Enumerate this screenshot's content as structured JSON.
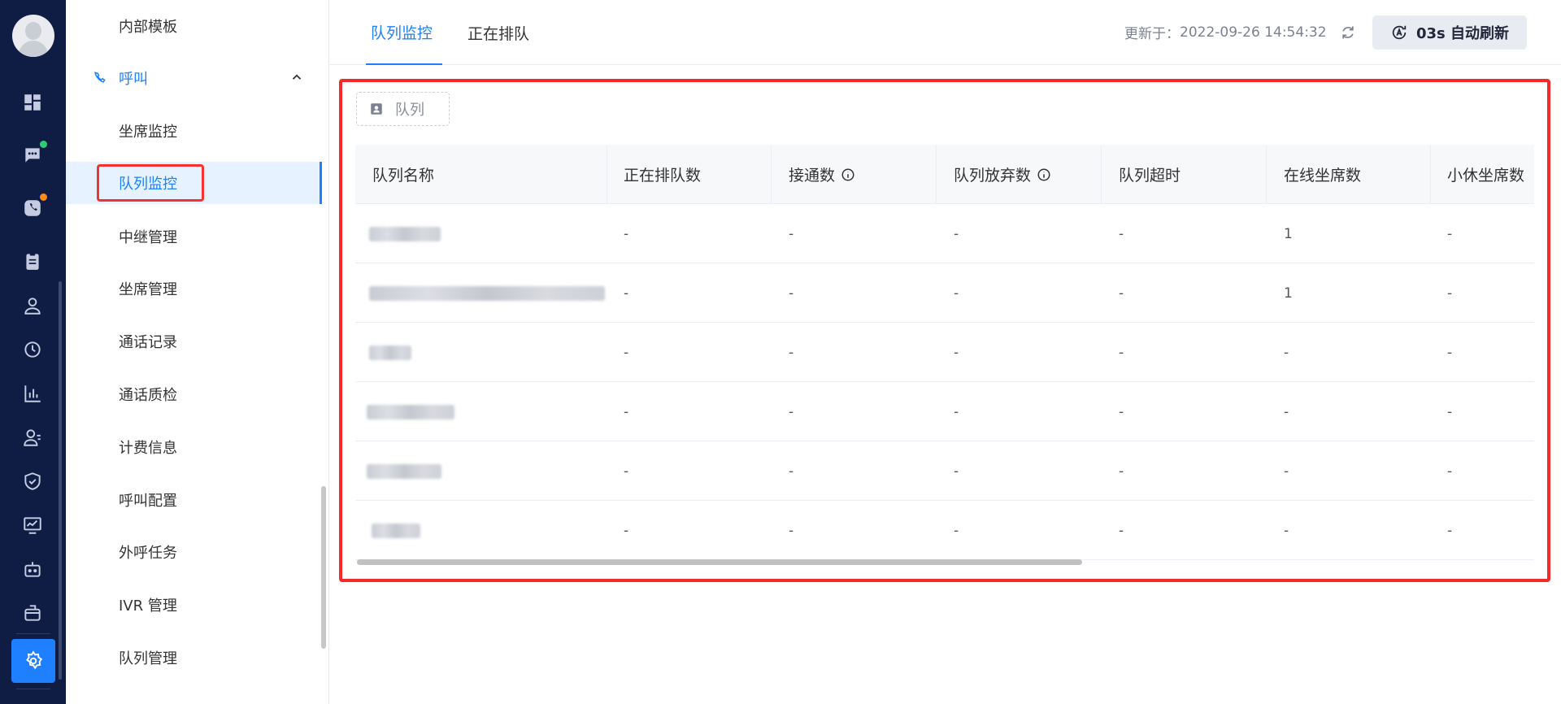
{
  "sidebar": {
    "items": [
      {
        "label": "内部模板"
      },
      {
        "label": "呼叫"
      },
      {
        "label": "坐席监控"
      },
      {
        "label": "队列监控"
      },
      {
        "label": "中继管理"
      },
      {
        "label": "坐席管理"
      },
      {
        "label": "通话记录"
      },
      {
        "label": "通话质检"
      },
      {
        "label": "计费信息"
      },
      {
        "label": "呼叫配置"
      },
      {
        "label": "外呼任务"
      },
      {
        "label": "IVR 管理"
      },
      {
        "label": "队列管理"
      }
    ]
  },
  "rail": {
    "icons": [
      "dashboard-icon",
      "chat-icon",
      "phone-icon",
      "clipboard-icon",
      "user-icon",
      "history-icon",
      "bar-chart-icon",
      "contacts-icon",
      "shield-icon",
      "monitor-icon",
      "robot-icon",
      "mailbox-icon",
      "settings-icon"
    ],
    "badge_colors": {
      "chat": "#2ecc71",
      "phone": "#ff8a1e"
    }
  },
  "tabs": [
    {
      "label": "队列监控"
    },
    {
      "label": "正在排队"
    }
  ],
  "header": {
    "updated_label": "更新于：",
    "updated_time": "2022-09-26 14:54:32",
    "auto_refresh": "03s 自动刷新"
  },
  "filter": {
    "label": "队列"
  },
  "table": {
    "columns": [
      "队列名称",
      "正在排队数",
      "接通数",
      "队列放弃数",
      "队列超时",
      "在线坐席数",
      "小休坐席数"
    ],
    "rows": [
      {
        "waiting": "-",
        "answered": "-",
        "abandoned": "-",
        "timeout": "-",
        "online": "1",
        "break": "-"
      },
      {
        "waiting": "-",
        "answered": "-",
        "abandoned": "-",
        "timeout": "-",
        "online": "1",
        "break": "-"
      },
      {
        "waiting": "-",
        "answered": "-",
        "abandoned": "-",
        "timeout": "-",
        "online": "-",
        "break": "-"
      },
      {
        "waiting": "-",
        "answered": "-",
        "abandoned": "-",
        "timeout": "-",
        "online": "-",
        "break": "-"
      },
      {
        "waiting": "-",
        "answered": "-",
        "abandoned": "-",
        "timeout": "-",
        "online": "-",
        "break": "-"
      },
      {
        "waiting": "-",
        "answered": "-",
        "abandoned": "-",
        "timeout": "-",
        "online": "-",
        "break": "-"
      }
    ]
  },
  "colors": {
    "accent": "#1e80ff",
    "rail_bg": "#0f1d45",
    "annotation": "#f42929"
  }
}
